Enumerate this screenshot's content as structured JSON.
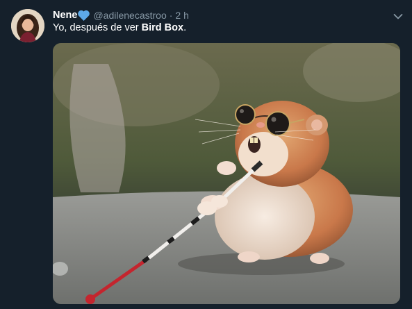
{
  "tweet": {
    "author_name": "Nene",
    "handle": "@adilenecastroo",
    "separator": "·",
    "timestamp": "2 h",
    "text_prefix": "Yo, después de ver ",
    "text_bold": "Bird Box",
    "text_suffix": ".",
    "avatar_icon": "user-avatar",
    "verified_heart_icon": "blue-heart-icon",
    "menu_icon": "chevron-down-icon"
  },
  "colors": {
    "background": "#15202b",
    "secondary_text": "#8899a6",
    "heart": "#5da9e9"
  }
}
